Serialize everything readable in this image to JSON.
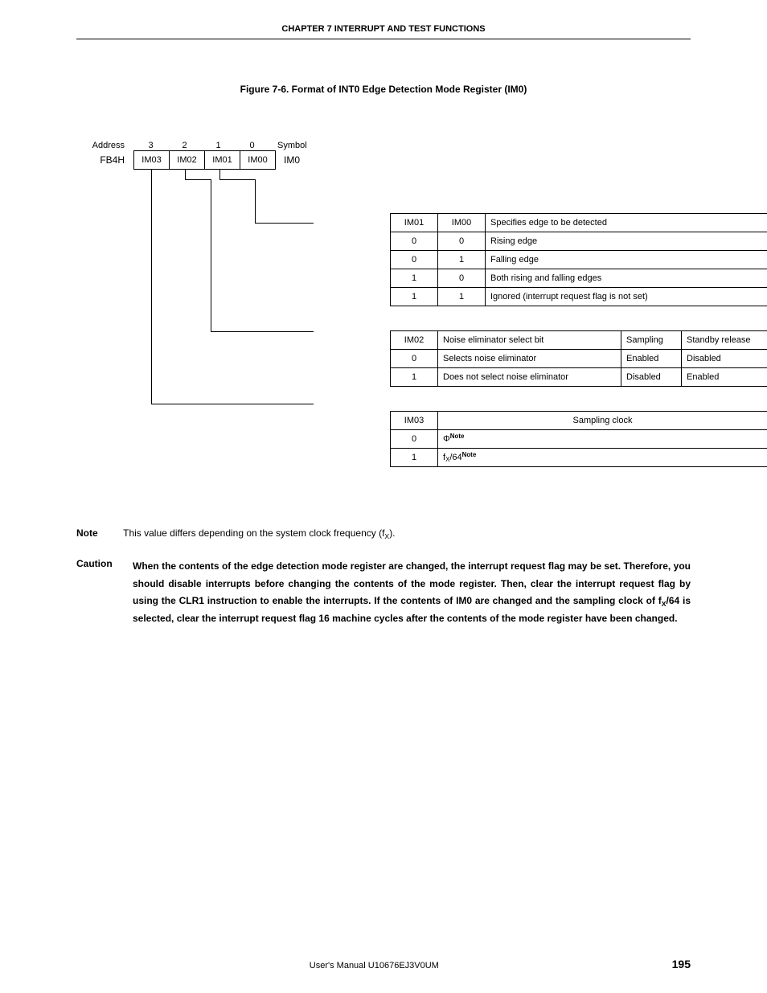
{
  "chapter_header": "CHAPTER 7   INTERRUPT AND TEST FUNCTIONS",
  "figure_title": "Figure 7-6.  Format of INT0 Edge Detection Mode Register (IM0)",
  "bits": {
    "address_label": "Address",
    "address_value": "FB4H",
    "col_labels": [
      "3",
      "2",
      "1",
      "0"
    ],
    "values": [
      "IM03",
      "IM02",
      "IM01",
      "IM00"
    ],
    "symbol_label": "Symbol",
    "symbol_value": "IM0"
  },
  "table1": {
    "header": [
      "IM01",
      "IM00",
      "Specifies edge to be detected"
    ],
    "rows": [
      [
        "0",
        "0",
        "Rising edge"
      ],
      [
        "0",
        "1",
        "Falling edge"
      ],
      [
        "1",
        "0",
        "Both rising and falling edges"
      ],
      [
        "1",
        "1",
        "Ignored (interrupt request flag is not set)"
      ]
    ]
  },
  "table2": {
    "header": [
      "IM02",
      "Noise eliminator select bit",
      "Sampling",
      "Standby release"
    ],
    "rows": [
      [
        "0",
        "Selects noise eliminator",
        "Enabled",
        "Disabled"
      ],
      [
        "1",
        "Does not select noise eliminator",
        "Disabled",
        "Enabled"
      ]
    ]
  },
  "table3": {
    "header": [
      "IM03",
      "Sampling clock"
    ],
    "rows": [
      [
        "0",
        "Φ",
        "Note"
      ],
      [
        "1",
        "fX/64",
        "Note"
      ]
    ]
  },
  "note_label": "Note",
  "note_text_pre": "This value differs depending on the system clock frequency (f",
  "note_text_sub": "X",
  "note_text_post": ").",
  "caution_label": "Caution",
  "caution_text_1": "When the contents of the edge detection mode register are changed, the interrupt request flag may be set.  Therefore, you should disable interrupts before changing the contents of the mode register.  Then, clear the interrupt request flag by using the CLR1 instruction to enable the interrupts.  If the contents of IM0 are changed and the sampling clock of f",
  "caution_text_sub": "X",
  "caution_text_2": "/64 is selected, clear the interrupt request flag 16 machine cycles after the contents of the mode register have been changed.",
  "footer_center": "User's Manual  U10676EJ3V0UM",
  "footer_page": "195"
}
